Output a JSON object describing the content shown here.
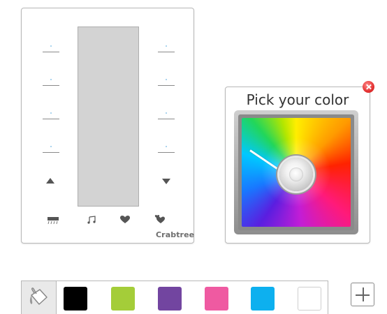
{
  "panel": {
    "brand": "Crabtree"
  },
  "picker": {
    "title": "Pick your color"
  },
  "swatches": [
    {
      "name": "black",
      "color": "#000000"
    },
    {
      "name": "lime",
      "color": "#a4cd39"
    },
    {
      "name": "purple",
      "color": "#7245a0"
    },
    {
      "name": "pink",
      "color": "#ef5aa1"
    },
    {
      "name": "blue",
      "color": "#0db0ef"
    },
    {
      "name": "white",
      "color": "#ffffff"
    }
  ],
  "icons": {
    "bucket": "paint-bucket-icon",
    "add": "plus-icon",
    "close": "close-icon"
  }
}
